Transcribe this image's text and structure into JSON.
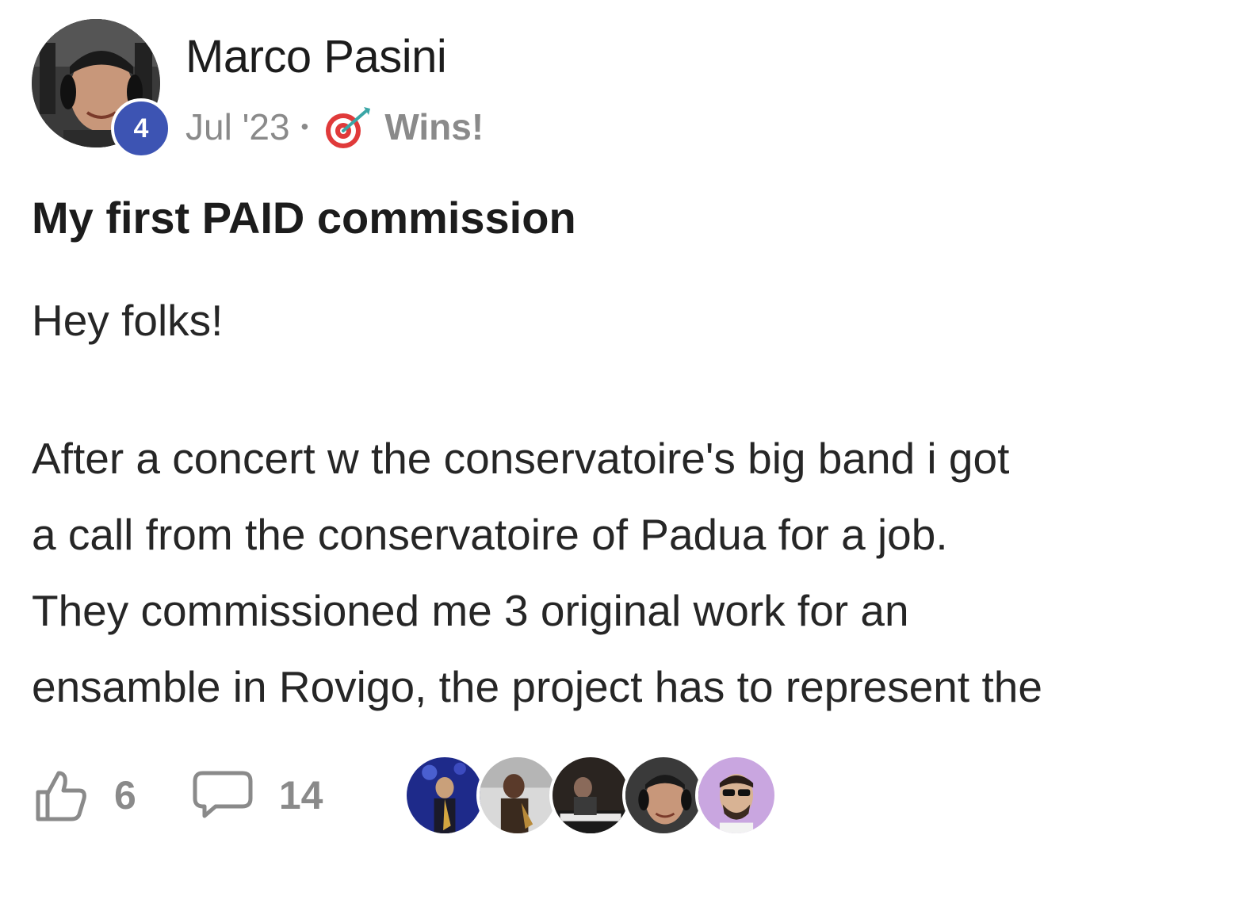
{
  "author": {
    "name": "Marco Pasini",
    "level": "4"
  },
  "meta": {
    "date": "Jul '23",
    "separator": "•",
    "category_icon": "target-dart-icon",
    "category": "Wins!"
  },
  "post": {
    "title": "My first PAID commission",
    "greeting": "Hey folks!",
    "body_lines": [
      "After a concert w the conservatoire's big band i got",
      "a call from the conservatoire of Padua for a job.",
      "They commissioned me 3 original work for an",
      "ensamble in Rovigo, the project has to represent the"
    ]
  },
  "footer": {
    "like_icon": "thumbs-up-icon",
    "like_count": "6",
    "comment_icon": "comment-bubble-icon",
    "comment_count": "14",
    "participants": [
      "participant-avatar-1",
      "participant-avatar-2",
      "participant-avatar-3",
      "participant-avatar-4",
      "participant-avatar-5"
    ]
  },
  "colors": {
    "level_badge": "#3d54b3",
    "meta_text": "#8a8a8a",
    "body_text": "#262626"
  }
}
